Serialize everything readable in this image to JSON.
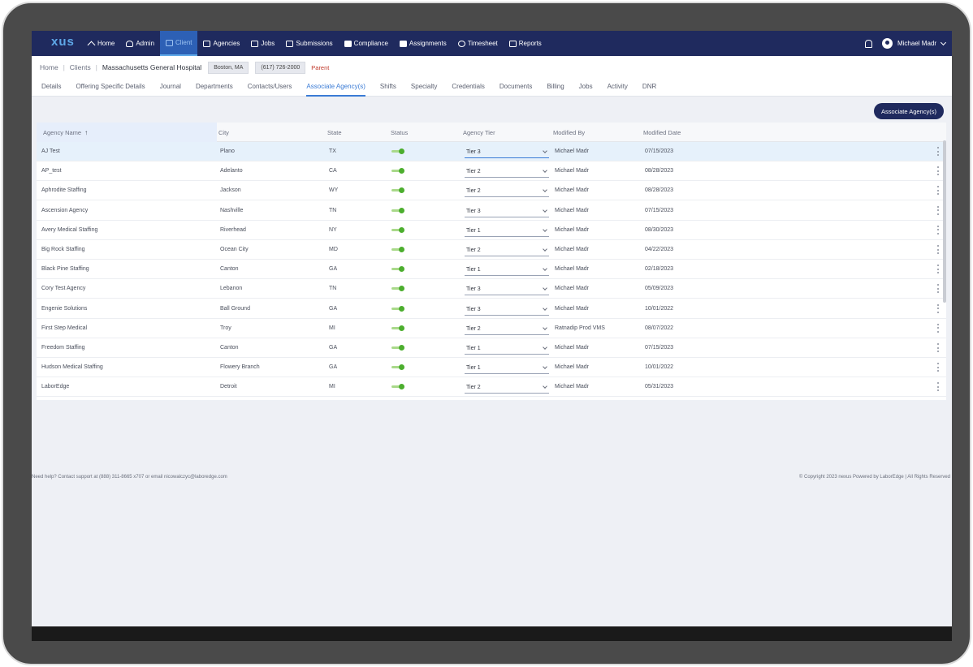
{
  "app": {
    "logo_text": "xus",
    "accent_color": "#1f2a5e",
    "active_color": "#3a7bd5"
  },
  "nav": {
    "items": [
      {
        "label": "Home",
        "icon": "home-icon"
      },
      {
        "label": "Admin",
        "icon": "user-icon"
      },
      {
        "label": "Client",
        "icon": "briefcase-icon",
        "active": true
      },
      {
        "label": "Agencies",
        "icon": "building-icon"
      },
      {
        "label": "Jobs",
        "icon": "search-people-icon"
      },
      {
        "label": "Submissions",
        "icon": "search-people-icon"
      },
      {
        "label": "Compliance",
        "icon": "checkbox-icon"
      },
      {
        "label": "Assignments",
        "icon": "clipboard-icon"
      },
      {
        "label": "Timesheet",
        "icon": "clock-icon"
      },
      {
        "label": "Reports",
        "icon": "report-icon"
      }
    ],
    "user_name": "Michael Madr"
  },
  "breadcrumb": {
    "home": "Home",
    "clients": "Clients",
    "current": "Massachusetts General Hospital",
    "location": "Boston, MA",
    "phone": "(617) 726-2000",
    "parent_label": "Parent"
  },
  "tabs": [
    "Details",
    "Offering Specific Details",
    "Journal",
    "Departments",
    "Contacts/Users",
    "Associate Agency(s)",
    "Shifts",
    "Specialty",
    "Credentials",
    "Documents",
    "Billing",
    "Jobs",
    "Activity",
    "DNR"
  ],
  "active_tab": "Associate Agency(s)",
  "associate_button": "Associate Agency(s)",
  "table": {
    "headers": {
      "agency_name": "Agency Name",
      "sort_indicator": "↑",
      "city": "City",
      "state": "State",
      "status": "Status",
      "agency_tier": "Agency Tier",
      "modified_by": "Modified By",
      "modified_date": "Modified Date"
    },
    "rows": [
      {
        "name": "AJ Test",
        "city": "Plano",
        "state": "TX",
        "tier": "Tier 3",
        "modified_by": "Michael Madr",
        "date": "07/15/2023"
      },
      {
        "name": "AP_test",
        "city": "Adelanto",
        "state": "CA",
        "tier": "Tier 2",
        "modified_by": "Michael Madr",
        "date": "08/28/2023"
      },
      {
        "name": "Aphrodite Staffing",
        "city": "Jackson",
        "state": "WY",
        "tier": "Tier 2",
        "modified_by": "Michael Madr",
        "date": "08/28/2023"
      },
      {
        "name": "Ascension Agency",
        "city": "Nashville",
        "state": "TN",
        "tier": "Tier 3",
        "modified_by": "Michael Madr",
        "date": "07/15/2023"
      },
      {
        "name": "Avery Medical Staffing",
        "city": "Riverhead",
        "state": "NY",
        "tier": "Tier 1",
        "modified_by": "Michael Madr",
        "date": "08/30/2023"
      },
      {
        "name": "Big Rock Staffing",
        "city": "Ocean City",
        "state": "MD",
        "tier": "Tier 2",
        "modified_by": "Michael Madr",
        "date": "04/22/2023"
      },
      {
        "name": "Black Pine Staffing",
        "city": "Canton",
        "state": "GA",
        "tier": "Tier 1",
        "modified_by": "Michael Madr",
        "date": "02/18/2023"
      },
      {
        "name": "Cory Test Agency",
        "city": "Lebanon",
        "state": "TN",
        "tier": "Tier 3",
        "modified_by": "Michael Madr",
        "date": "05/09/2023"
      },
      {
        "name": "Engenie Solutions",
        "city": "Ball Ground",
        "state": "GA",
        "tier": "Tier 3",
        "modified_by": "Michael Madr",
        "date": "10/01/2022"
      },
      {
        "name": "First Step Medical",
        "city": "Troy",
        "state": "MI",
        "tier": "Tier 2",
        "modified_by": "Ratnadip Prod VMS",
        "date": "08/07/2022"
      },
      {
        "name": "Freedom Staffing",
        "city": "Canton",
        "state": "GA",
        "tier": "Tier 1",
        "modified_by": "Michael Madr",
        "date": "07/15/2023"
      },
      {
        "name": "Hudson Medical Staffing",
        "city": "Flowery Branch",
        "state": "GA",
        "tier": "Tier 1",
        "modified_by": "Michael Madr",
        "date": "10/01/2022"
      },
      {
        "name": "LaborEdge",
        "city": "Detroit",
        "state": "MI",
        "tier": "Tier 2",
        "modified_by": "Michael Madr",
        "date": "05/31/2023"
      }
    ]
  },
  "footer": {
    "help": "Need help? Contact support at (888) 311-8665 x707 or email nicowalczyc@laboredge.com",
    "copyright": "© Copyright 2023 nexus Powered by LaborEdge | All Rights Reserved"
  }
}
